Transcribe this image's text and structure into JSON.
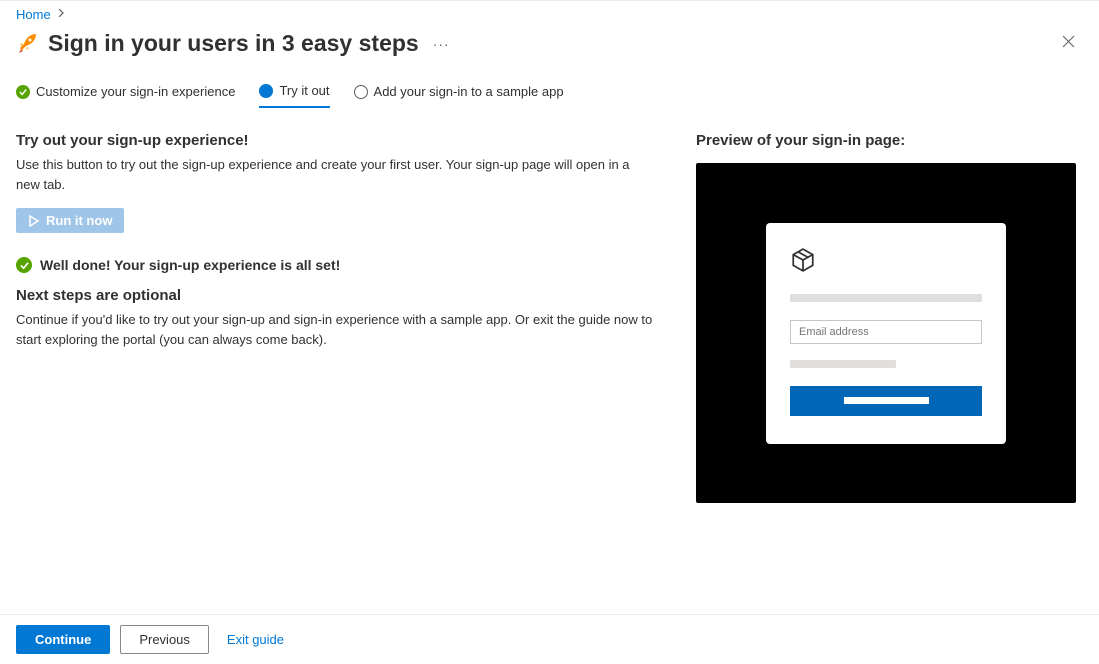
{
  "breadcrumb": {
    "home": "Home"
  },
  "header": {
    "title": "Sign in your users in 3 easy steps"
  },
  "steps": [
    {
      "label": "Customize your sign-in experience",
      "state": "done"
    },
    {
      "label": "Try it out",
      "state": "current"
    },
    {
      "label": "Add your sign-in to a sample app",
      "state": "todo"
    }
  ],
  "tryout": {
    "title": "Try out your sign-up experience!",
    "description": "Use this button to try out the sign-up experience and create your first user. Your sign-up page will open in a new tab.",
    "run_button": "Run it now"
  },
  "success": {
    "message": "Well done! Your sign-up experience is all set!"
  },
  "next": {
    "title": "Next steps are optional",
    "description": "Continue if you'd like to try out your sign-up and sign-in experience with a sample app. Or exit the guide now to start exploring the portal (you can always come back)."
  },
  "preview": {
    "title": "Preview of your sign-in page:",
    "email_placeholder": "Email address"
  },
  "footer": {
    "continue": "Continue",
    "previous": "Previous",
    "exit": "Exit guide"
  }
}
